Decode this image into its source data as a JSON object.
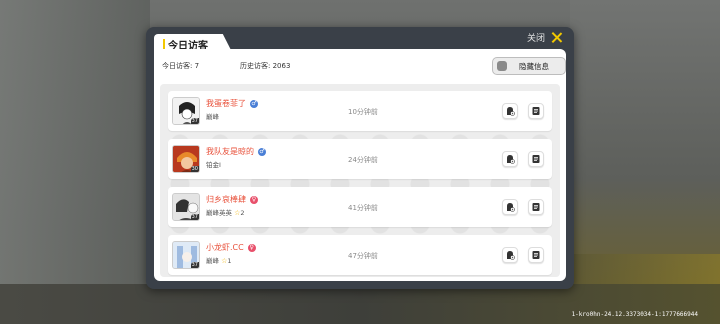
{
  "header": {
    "title": "今日访客",
    "close_label": "关闭"
  },
  "stats": {
    "today": "今日访客: 7",
    "history": "历史访客: 2063"
  },
  "hide_button": {
    "label": "隐藏信息"
  },
  "visitors": [
    {
      "name": "我蛋卷菲了",
      "rank": "巅峰",
      "stars": "",
      "time": "10分钟前",
      "gender": "male",
      "level": "37",
      "avatar_color": "#e9e9e9"
    },
    {
      "name": "我队友是晾的",
      "rank": "铂金I",
      "stars": "",
      "time": "24分钟前",
      "gender": "male",
      "level": "30",
      "avatar_color": "#c2432a"
    },
    {
      "name": "归乡哀棒肆",
      "rank": "巅峰英英",
      "stars": "2",
      "time": "41分钟前",
      "gender": "female",
      "level": "37",
      "avatar_color": "#dedede"
    },
    {
      "name": "小龙虾.CC",
      "rank": "巅峰",
      "stars": "1",
      "time": "47分钟前",
      "gender": "female",
      "level": "37",
      "avatar_color": "#cfe0f2"
    }
  ],
  "colors": {
    "accent": "#f2c800",
    "name": "#e8503a",
    "male": "#4a7fd6",
    "female": "#e8506b"
  },
  "footer": {
    "build_id": "1-kro0hn-24.12.3373034-1:1777666944"
  }
}
